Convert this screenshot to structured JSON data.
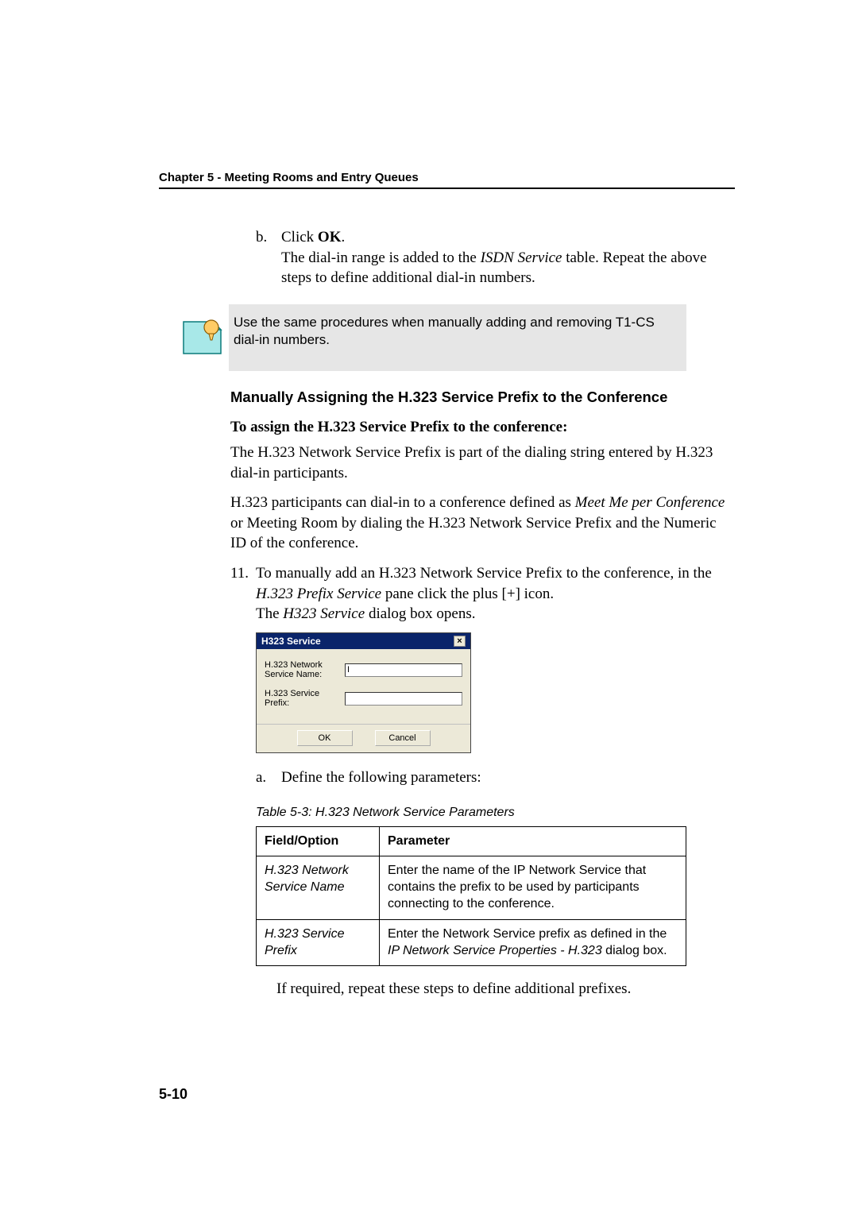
{
  "header": {
    "chapter": "Chapter 5 - Meeting Rooms and Entry Queues"
  },
  "step_b": {
    "letter": "b.",
    "click_prefix": "Click ",
    "click_bold": "OK",
    "click_suffix": ".",
    "line2_pre": "The dial-in range is added to the ",
    "line2_ital": "ISDN Service",
    "line2_post": " table. Repeat the above steps to define additional dial-in numbers."
  },
  "note": {
    "text": "Use the same procedures when manually adding and removing T1-CS dial-in numbers."
  },
  "section": {
    "title": "Manually Assigning the H.323 Service Prefix to the Conference",
    "subtitle": "To assign the H.323 Service Prefix to the conference:",
    "p1": "The H.323 Network Service Prefix is part of the dialing string entered by H.323 dial-in participants.",
    "p2_pre": "H.323 participants can dial-in to a conference defined as ",
    "p2_ital": "Meet Me per Conference",
    "p2_post": " or Meeting Room by dialing the H.323 Network Service Prefix and the Numeric ID of the conference."
  },
  "step11": {
    "num": "11.",
    "line_pre": "To manually add an H.323 Network Service Prefix to the conference, in the ",
    "line_ital": "H.323 Prefix Service",
    "line_mid": " pane click the plus [+] icon.",
    "line2_pre": "The ",
    "line2_ital": "H323 Service",
    "line2_post": " dialog box opens."
  },
  "dialog": {
    "title": "H323 Service",
    "label1": "H.323 Network Service Name:",
    "label2": "H.323 Service Prefix:",
    "field1_value": "I",
    "ok": "OK",
    "cancel": "Cancel",
    "close": "×"
  },
  "step_a": {
    "letter": "a.",
    "text": "Define the following parameters:"
  },
  "table": {
    "caption": "Table 5-3: H.323 Network Service Parameters",
    "head_field": "Field/Option",
    "head_param": "Parameter",
    "rows": [
      {
        "field": "H.323 Network Service Name",
        "param": "Enter the name of the IP Network Service that contains the prefix to be used by participants connecting to the conference."
      },
      {
        "field": "H.323 Service Prefix",
        "param_pre": "Enter the Network Service prefix as defined in the ",
        "param_ital": "IP Network Service Properties - H.323",
        "param_post": " dialog box."
      }
    ]
  },
  "after_table": "If required, repeat these steps to define additional prefixes.",
  "page_number": "5-10"
}
